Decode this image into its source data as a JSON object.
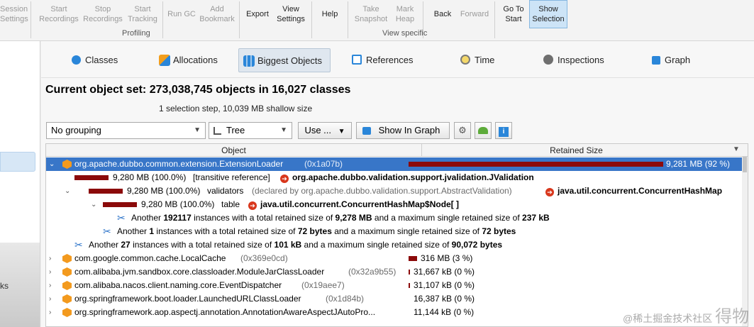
{
  "toolbar": {
    "buttons": [
      {
        "label": "Session\nSettings",
        "disabled": true
      },
      {
        "label": "Start\nRecordings",
        "disabled": true
      },
      {
        "label": "Stop\nRecordings",
        "disabled": true
      },
      {
        "label": "Start\nTracking",
        "disabled": true
      },
      {
        "label": "Run GC",
        "disabled": true
      },
      {
        "label": "Add\nBookmark",
        "disabled": true
      },
      {
        "label": "Export",
        "disabled": false
      },
      {
        "label": "View\nSettings",
        "disabled": false
      },
      {
        "label": "Help",
        "disabled": false
      },
      {
        "label": "Take\nSnapshot",
        "disabled": true
      },
      {
        "label": "Mark\nHeap",
        "disabled": true
      },
      {
        "label": "Back",
        "disabled": false
      },
      {
        "label": "Forward",
        "disabled": true
      },
      {
        "label": "Go To\nStart",
        "disabled": false
      },
      {
        "label": "Show\nSelection",
        "disabled": false
      }
    ],
    "groups": {
      "profiling": "Profiling",
      "view_specific": "View specific"
    }
  },
  "sidebar": {
    "fragment": "ks"
  },
  "tabs": [
    {
      "label": "Classes",
      "icon": "classes-icon"
    },
    {
      "label": "Allocations",
      "icon": "allocations-icon"
    },
    {
      "label": "Biggest Objects",
      "icon": "biggest-objects-icon"
    },
    {
      "label": "References",
      "icon": "references-icon"
    },
    {
      "label": "Time",
      "icon": "time-icon"
    },
    {
      "label": "Inspections",
      "icon": "inspections-icon"
    },
    {
      "label": "Graph",
      "icon": "graph-icon"
    }
  ],
  "header": {
    "title": "Current object set:  273,038,745 objects in 16,027 classes",
    "subtitle": "1 selection step, 10,039 MB shallow size"
  },
  "controls": {
    "grouping": "No grouping",
    "view_mode": "Tree",
    "use_label": "Use ...",
    "show_in_graph": "Show In Graph"
  },
  "table": {
    "col_object": "Object",
    "col_retained": "Retained Size",
    "rows": {
      "r1": {
        "name": "org.apache.dubbo.common.extension.ExtensionLoader",
        "id": "(0x1a07b)",
        "retained": "9,281 MB (92 %)",
        "fraction": 0.92
      },
      "r2": {
        "size": "9,280 MB (100.0%)",
        "field": "[transitive reference]",
        "target": "org.apache.dubbo.validation.support.jvalidation.JValidation"
      },
      "r3": {
        "size": "9,280 MB (100.0%)",
        "field": "validators",
        "declared": "(declared by org.apache.dubbo.validation.support.AbstractValidation)",
        "target": "java.util.concurrent.ConcurrentHashMap"
      },
      "r4": {
        "size": "9,280 MB (100.0%)",
        "field": "table",
        "target": "java.util.concurrent.ConcurrentHashMap$Node[ ]"
      },
      "r5": {
        "pre": "Another ",
        "count": "192117",
        "mid": " instances with a total retained size of ",
        "total": "9,278 MB",
        "post": " and a maximum single retained size of ",
        "max": "237 kB"
      },
      "r6": {
        "pre": "Another ",
        "count": "1",
        "mid": " instances with a total retained size of ",
        "total": "72 bytes",
        "post": " and a maximum single retained size of ",
        "max": "72 bytes"
      },
      "r7": {
        "pre": "Another ",
        "count": "27",
        "mid": " instances with a total retained size of ",
        "total": "101 kB",
        "post": " and a maximum single retained size of ",
        "max": "90,072 bytes"
      },
      "r8": {
        "name": "com.google.common.cache.LocalCache",
        "id": "(0x369e0cd)",
        "retained": "316 MB (3 %)",
        "fraction": 0.03
      },
      "r9": {
        "name": "com.alibaba.jvm.sandbox.core.classloader.ModuleJarClassLoader",
        "id": "(0x32a9b55)",
        "retained": "31,667 kB (0 %)",
        "fraction": 0.003
      },
      "r10": {
        "name": "com.alibaba.nacos.client.naming.core.EventDispatcher",
        "id": "(0x19aee7)",
        "retained": "31,107 kB (0 %)",
        "fraction": 0.003
      },
      "r11": {
        "name": "org.springframework.boot.loader.LaunchedURLClassLoader",
        "id": "(0x1d84b)",
        "retained": "16,387 kB (0 %)",
        "fraction": 0.0
      },
      "r12": {
        "name": "org.springframework.aop.aspectj.annotation.AnnotationAwareAspectJAutoPro...",
        "id": "",
        "retained": "11,144 kB (0 %)",
        "fraction": 0.0
      }
    }
  },
  "watermark": {
    "text": "@稀土掘金技术社区",
    "big": "得物"
  },
  "colors": {
    "selection": "#3876c8",
    "bar": "#8b0a0a",
    "class_icon": "#f39a1e",
    "ref_icon": "#d8371c"
  }
}
